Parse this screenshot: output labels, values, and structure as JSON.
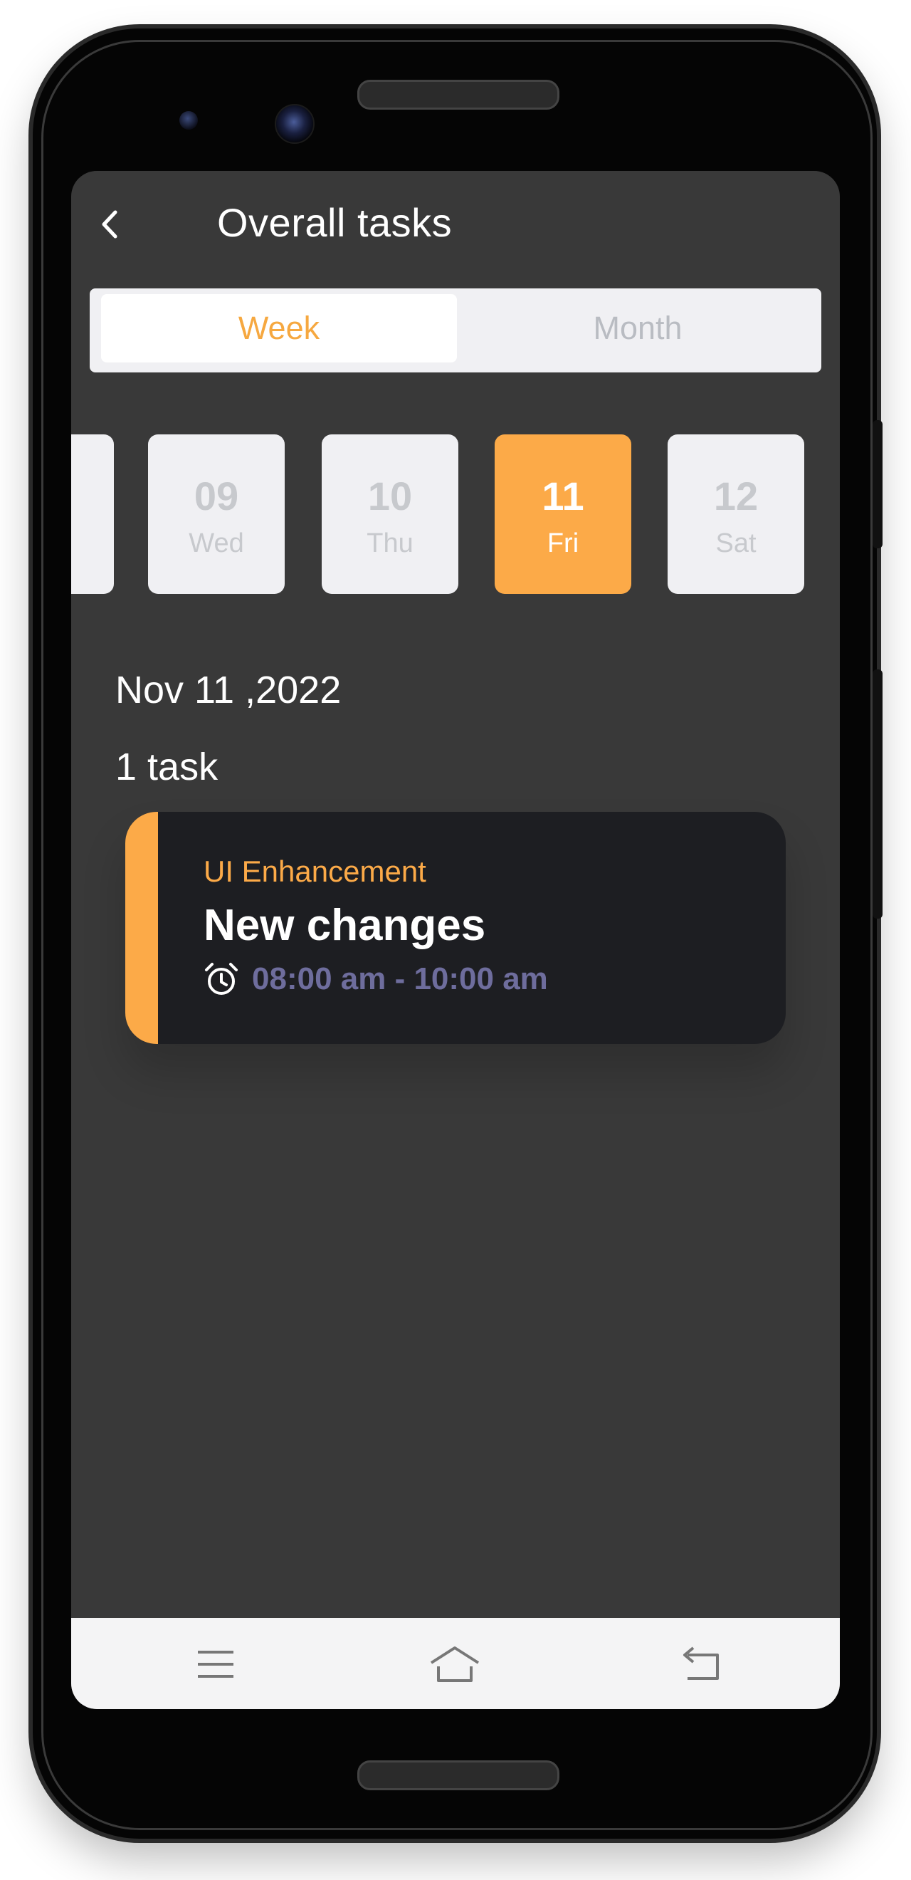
{
  "header": {
    "title": "Overall tasks"
  },
  "segment": {
    "tabs": [
      "Week",
      "Month"
    ],
    "active": "Week"
  },
  "days": [
    {
      "num": "09",
      "weekday": "Wed",
      "active": false
    },
    {
      "num": "10",
      "weekday": "Thu",
      "active": false
    },
    {
      "num": "11",
      "weekday": "Fri",
      "active": true
    },
    {
      "num": "12",
      "weekday": "Sat",
      "active": false
    }
  ],
  "selected_date": "Nov 11 ,2022",
  "task_count": "1 task",
  "tasks": [
    {
      "category": "UI Enhancement",
      "title": "New changes",
      "time": "08:00 am - 10:00 am"
    }
  ],
  "navbar": {
    "icons": [
      "menu-icon",
      "home-icon",
      "back-icon"
    ]
  },
  "colors": {
    "accent": "#fcaa48",
    "screen_bg": "#393939",
    "card_bg": "#1d1e22",
    "time_text": "#6e6d9d"
  }
}
